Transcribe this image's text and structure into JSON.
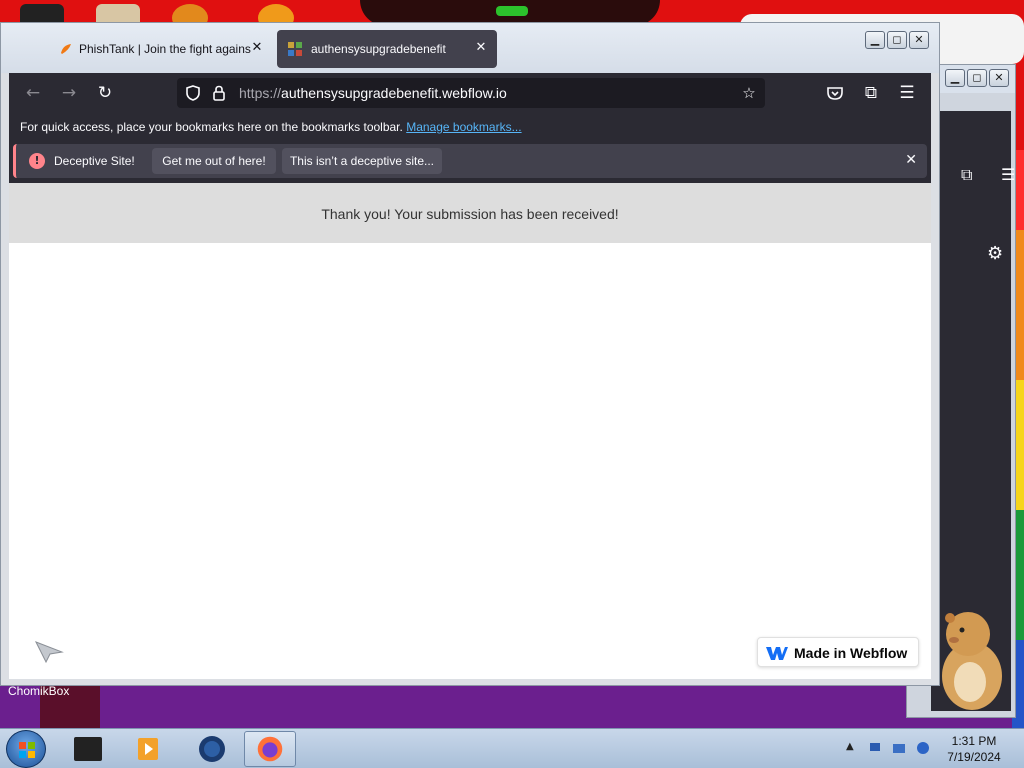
{
  "browser": {
    "tabs": [
      {
        "title": "PhishTank | Join the fight against phishing",
        "active": false
      },
      {
        "title": "authensysupgradebenefit",
        "active": true
      }
    ],
    "url": {
      "scheme": "https://",
      "host": "authensysupgradebenefit.webflow.io"
    },
    "bookmarks_bar": {
      "text": "For quick access, place your bookmarks here on the bookmarks toolbar.",
      "link": "Manage bookmarks..."
    },
    "warning": {
      "label": "Deceptive Site!",
      "primary_button": "Get me out of here!",
      "secondary_button": "This isn’t a deceptive site..."
    }
  },
  "page": {
    "message": "Thank you! Your submission has been received!",
    "badge": "Made in Webflow"
  },
  "desktop": {
    "label": "ChomikBox"
  },
  "taskbar": {
    "time": "1:31 PM",
    "date": "7/19/2024"
  },
  "colors": {
    "toolbar": "#2b2a33",
    "active_tab": "#42414d",
    "warning": "#ff848b",
    "link": "#57b5f7"
  }
}
